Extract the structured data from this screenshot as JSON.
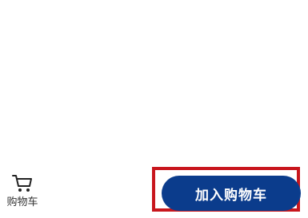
{
  "bottom_bar": {
    "cart_nav": {
      "icon": "shopping-cart-icon",
      "label": "购物车"
    },
    "add_to_cart_button": {
      "label": "加入购物车"
    }
  },
  "colors": {
    "button_bg": "#0b3c8c",
    "button_text": "#ffffff",
    "highlight_border": "#c8161d",
    "label_text": "#333333"
  }
}
